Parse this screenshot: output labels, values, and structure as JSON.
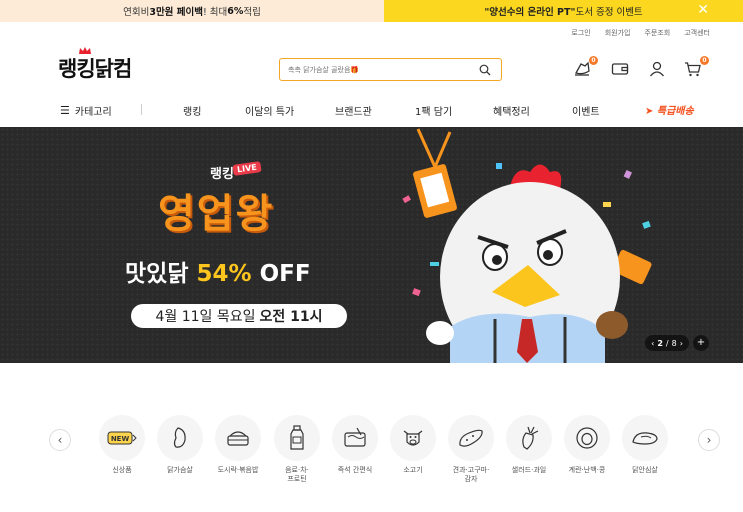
{
  "topbar": {
    "left_pre": "연회비 ",
    "left_bold1": "3만원 페이백",
    "left_mid": "! 최대 ",
    "left_bold2": "6%",
    "left_post": " 적립",
    "right_bold": "\"양선수의 온라인 PT\"",
    "right_post": " 도서 증정 이벤트"
  },
  "util_links": [
    "로그인",
    "회원가입",
    "주문조회",
    "고객센터"
  ],
  "logo": "랭킹닭컴",
  "search": {
    "placeholder": "촉촉 닭가슴살 골랐음🎁"
  },
  "header_badges": {
    "recent": "0",
    "cart": "0"
  },
  "nav": {
    "category": "카테고리",
    "items": [
      "랭킹",
      "이달의 특가",
      "브랜드관",
      "1팩 담기",
      "혜택정리",
      "이벤트"
    ],
    "express": "특급배송"
  },
  "banner": {
    "brand": "랭킹",
    "live": "LIVE",
    "headline": "영업왕",
    "sub_pre": "맛있닭 ",
    "sub_pct": "54%",
    "sub_post": " OFF",
    "date_pre": "4월 11일 목요일",
    "date_bold": "오전 11시",
    "pager_current": "2",
    "pager_sep": "/",
    "pager_total": "8"
  },
  "categories": [
    {
      "label": "신상품",
      "icon": "new-icon"
    },
    {
      "label": "닭가슴살",
      "icon": "chicken-breast-icon"
    },
    {
      "label": "도시락·볶음밥",
      "icon": "lunchbox-icon"
    },
    {
      "label": "음료·차·\n프로틴",
      "icon": "bottle-icon"
    },
    {
      "label": "즉석 간편식",
      "icon": "instant-food-icon"
    },
    {
      "label": "소고기",
      "icon": "cow-icon"
    },
    {
      "label": "견과·고구마·\n감자",
      "icon": "sweet-potato-icon"
    },
    {
      "label": "샐러드·과일",
      "icon": "carrot-icon"
    },
    {
      "label": "계란·난백·콩",
      "icon": "egg-icon"
    },
    {
      "label": "닭안심살",
      "icon": "tenderloin-icon"
    }
  ],
  "colors": {
    "accent": "#f7941d",
    "yellow": "#fbd81f",
    "express": "#f4511e"
  }
}
